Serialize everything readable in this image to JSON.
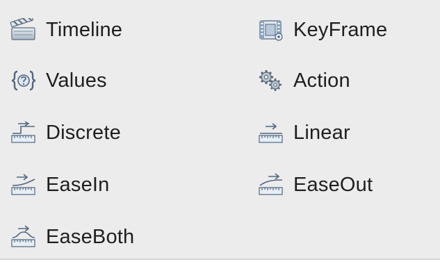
{
  "palette": {
    "items": [
      {
        "label": "Timeline",
        "icon": "clapperboard-icon"
      },
      {
        "label": "KeyFrame",
        "icon": "film-strip-icon"
      },
      {
        "label": "Values",
        "icon": "braces-icon"
      },
      {
        "label": "Action",
        "icon": "gears-icon"
      },
      {
        "label": "Discrete",
        "icon": "ruler-discrete-icon"
      },
      {
        "label": "Linear",
        "icon": "ruler-linear-icon"
      },
      {
        "label": "EaseIn",
        "icon": "ruler-easein-icon"
      },
      {
        "label": "EaseOut",
        "icon": "ruler-easeout-icon"
      },
      {
        "label": "EaseBoth",
        "icon": "ruler-easeboth-icon"
      }
    ]
  }
}
